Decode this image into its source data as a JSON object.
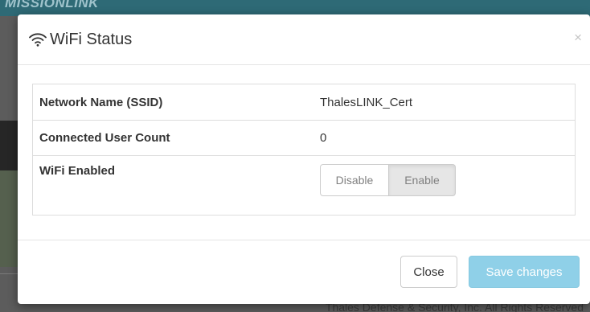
{
  "background": {
    "brand_text": "MISSIONLINK",
    "footer_text": "Thales Defense & Security, Inc. All Rights Reserved"
  },
  "modal": {
    "title": "WiFi Status",
    "title_icon": "wifi-icon",
    "close_symbol": "×",
    "rows": [
      {
        "label": "Network Name (SSID)",
        "value": "ThalesLINK_Cert"
      },
      {
        "label": "Connected User Count",
        "value": "0"
      },
      {
        "label": "WiFi Enabled",
        "options": [
          "Disable",
          "Enable"
        ],
        "selected": "Enable"
      }
    ],
    "footer": {
      "close_label": "Close",
      "save_label": "Save changes",
      "save_disabled": true
    }
  },
  "colors": {
    "header_bar": "#2e6a76",
    "save_button": "#8fd0e8",
    "selected_toggle": "#e6e6e6"
  }
}
